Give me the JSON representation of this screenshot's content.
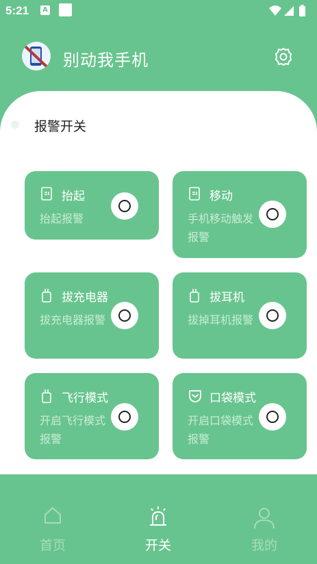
{
  "status_bar": {
    "time": "5:21",
    "notification_letter": "A"
  },
  "app_bar": {
    "title": "别动我手机"
  },
  "section": {
    "title": "报警开关"
  },
  "cards": [
    {
      "title": "抬起",
      "desc": "抬起报警",
      "icon": "phone-icon",
      "enabled": false
    },
    {
      "title": "移动",
      "desc": "手机移动触发报警",
      "icon": "phone-icon",
      "enabled": false
    },
    {
      "title": "拔充电器",
      "desc": "拔充电器报警",
      "icon": "plug-icon",
      "enabled": false
    },
    {
      "title": "拔耳机",
      "desc": "拔掉耳机报警",
      "icon": "plug-icon",
      "enabled": false
    },
    {
      "title": "飞行模式",
      "desc": "开启飞行模式报警",
      "icon": "plug-icon",
      "enabled": false
    },
    {
      "title": "口袋模式",
      "desc": "开启口袋模式报警",
      "icon": "pocket-icon",
      "enabled": false
    }
  ],
  "bottom_nav": {
    "items": [
      {
        "label": "首页",
        "icon": "home-icon",
        "active": false
      },
      {
        "label": "开关",
        "icon": "alarm-icon",
        "active": true
      },
      {
        "label": "我的",
        "icon": "user-icon",
        "active": false
      }
    ]
  },
  "colors": {
    "primary": "#68c48e",
    "card_desc": "#c8ecd6",
    "nav_inactive": "#a8dcbc"
  }
}
